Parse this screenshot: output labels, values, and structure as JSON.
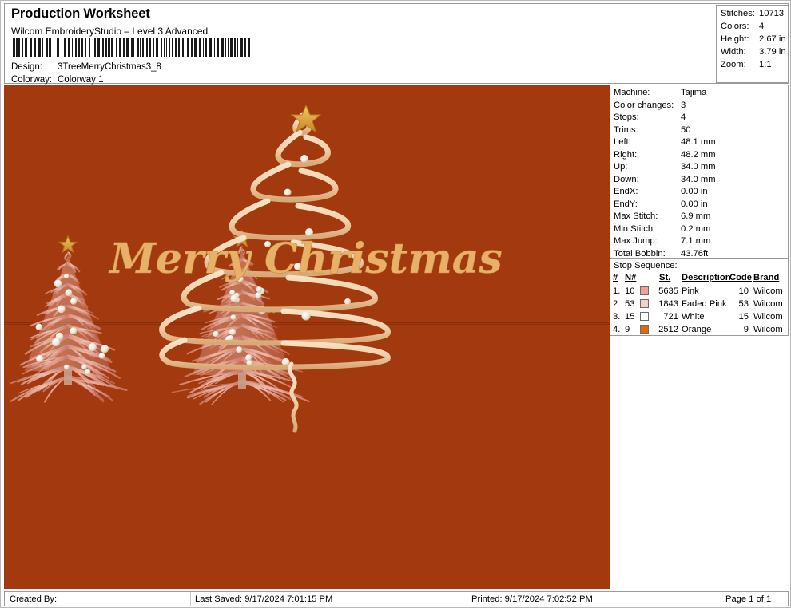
{
  "header": {
    "title": "Production Worksheet",
    "subtitle": "Wilcom EmbroideryStudio – Level 3 Advanced",
    "barcode_icon": "barcode-icon",
    "fields": [
      {
        "label": "Design:",
        "value": "3TreeMerryChristmas3_8"
      },
      {
        "label": "Colorway:",
        "value": "Colorway 1"
      }
    ]
  },
  "info_box": {
    "rows": [
      {
        "label": "Stitches:",
        "value": "10713"
      },
      {
        "label": "Colors:",
        "value": "4"
      },
      {
        "label": "Height:",
        "value": "2.67 in"
      },
      {
        "label": "Width:",
        "value": "3.79 in"
      },
      {
        "label": "Zoom:",
        "value": "1:1"
      }
    ]
  },
  "details": {
    "rows": [
      {
        "label": "Machine:",
        "value": "Tajima"
      },
      {
        "label": "Color changes:",
        "value": "3"
      },
      {
        "label": "Stops:",
        "value": "4"
      },
      {
        "label": "Trims:",
        "value": "50"
      },
      {
        "label": "Left:",
        "value": "48.1 mm"
      },
      {
        "label": "Right:",
        "value": "48.2 mm"
      },
      {
        "label": "Up:",
        "value": "34.0 mm"
      },
      {
        "label": "Down:",
        "value": "34.0 mm"
      },
      {
        "label": "EndX:",
        "value": "0.00 in"
      },
      {
        "label": "EndY:",
        "value": "0.00 in"
      },
      {
        "label": "Max Stitch:",
        "value": "6.9 mm"
      },
      {
        "label": "Min Stitch:",
        "value": "0.2 mm"
      },
      {
        "label": "Max Jump:",
        "value": "7.1 mm"
      },
      {
        "label": "Total Bobbin:",
        "value": "43.76ft"
      }
    ]
  },
  "stop_sequence": {
    "title": "Stop Sequence:",
    "columns": {
      "num": "#",
      "needle": "N#",
      "stitches": "St.",
      "description": "Description",
      "code": "Code",
      "brand": "Brand"
    },
    "rows": [
      {
        "num": "1.",
        "needle": "10",
        "swatch": "#eda297",
        "stitches": "5635",
        "description": "Pink",
        "code": "10",
        "brand": "Wilcom"
      },
      {
        "num": "2.",
        "needle": "53",
        "swatch": "#f7cfc6",
        "stitches": "1843",
        "description": "Faded Pink",
        "code": "53",
        "brand": "Wilcom"
      },
      {
        "num": "3.",
        "needle": "15",
        "swatch": "#ffffff",
        "stitches": "721",
        "description": "White",
        "code": "15",
        "brand": "Wilcom"
      },
      {
        "num": "4.",
        "needle": "9",
        "swatch": "#e2690a",
        "stitches": "2512",
        "description": "Orange",
        "code": "9",
        "brand": "Wilcom"
      }
    ]
  },
  "canvas": {
    "background_color": "#a3390e",
    "artwork_name": "three-christmas-trees-merry-christmas-embroidery-preview",
    "greeting_text": "Merry Christmas",
    "greeting_color": "#e8b169",
    "star_color": "#d89a2e",
    "tree_color": "#e3a79b",
    "ornament_color": "#f3efe2"
  },
  "footer": {
    "created_by": "Created By:",
    "last_saved": "Last Saved: 9/17/2024 7:01:15 PM",
    "printed": "Printed: 9/17/2024 7:02:52 PM",
    "page": "Page 1 of 1"
  }
}
